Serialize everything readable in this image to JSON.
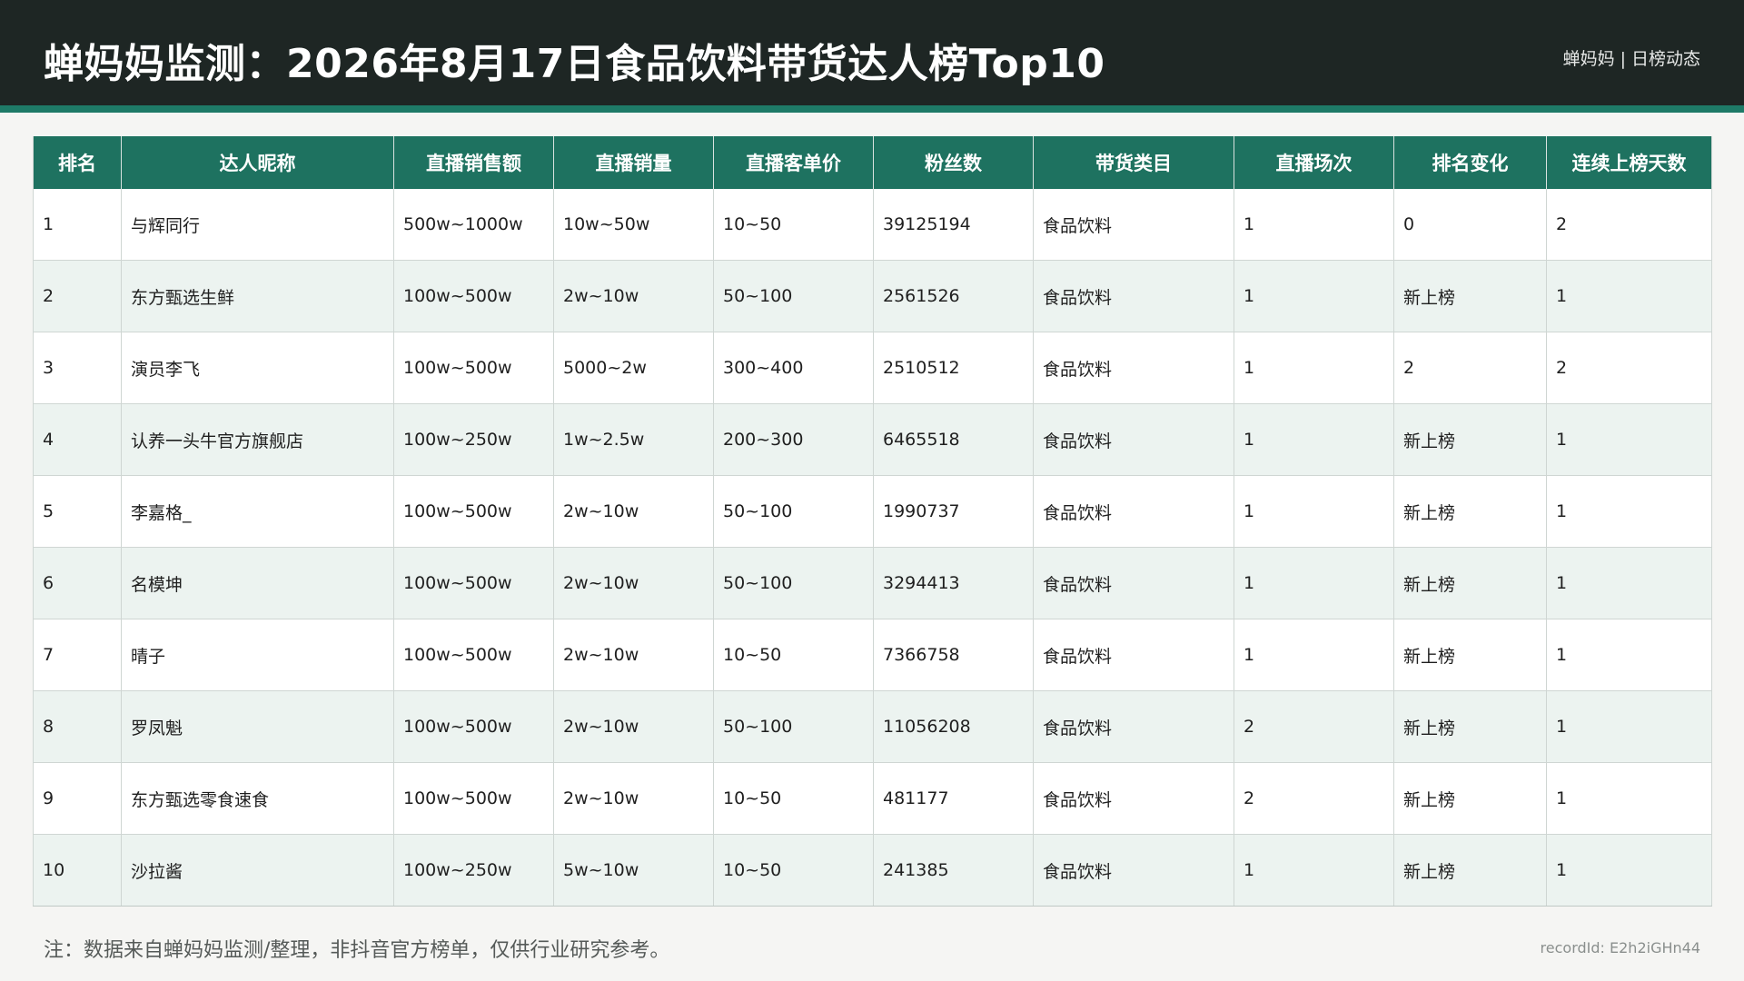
{
  "header": {
    "title": "蝉妈妈监测：2026年8月17日食品饮料带货达人榜Top10",
    "brand": "蝉妈妈",
    "brand_sep": "|",
    "brand_sub": "日榜动态"
  },
  "colors": {
    "header_bg": "#1e2624",
    "accent": "#1e7260",
    "row_alt": "#ecf3f0"
  },
  "table": {
    "columns": [
      "排名",
      "达人昵称",
      "直播销售额",
      "直播销量",
      "直播客单价",
      "粉丝数",
      "带货类目",
      "直播场次",
      "排名变化",
      "连续上榜天数"
    ],
    "rows": [
      [
        "1",
        "与辉同行",
        "500w~1000w",
        "10w~50w",
        "10~50",
        "39125194",
        "食品饮料",
        "1",
        "0",
        "2"
      ],
      [
        "2",
        "东方甄选生鲜",
        "100w~500w",
        "2w~10w",
        "50~100",
        "2561526",
        "食品饮料",
        "1",
        "新上榜",
        "1"
      ],
      [
        "3",
        "演员李飞",
        "100w~500w",
        "5000~2w",
        "300~400",
        "2510512",
        "食品饮料",
        "1",
        "2",
        "2"
      ],
      [
        "4",
        "认养一头牛官方旗舰店",
        "100w~250w",
        "1w~2.5w",
        "200~300",
        "6465518",
        "食品饮料",
        "1",
        "新上榜",
        "1"
      ],
      [
        "5",
        "李嘉格_",
        "100w~500w",
        "2w~10w",
        "50~100",
        "1990737",
        "食品饮料",
        "1",
        "新上榜",
        "1"
      ],
      [
        "6",
        "名模坤",
        "100w~500w",
        "2w~10w",
        "50~100",
        "3294413",
        "食品饮料",
        "1",
        "新上榜",
        "1"
      ],
      [
        "7",
        "晴子",
        "100w~500w",
        "2w~10w",
        "10~50",
        "7366758",
        "食品饮料",
        "1",
        "新上榜",
        "1"
      ],
      [
        "8",
        "罗凤魁",
        "100w~500w",
        "2w~10w",
        "50~100",
        "11056208",
        "食品饮料",
        "2",
        "新上榜",
        "1"
      ],
      [
        "9",
        "东方甄选零食速食",
        "100w~500w",
        "2w~10w",
        "10~50",
        "481177",
        "食品饮料",
        "2",
        "新上榜",
        "1"
      ],
      [
        "10",
        "沙拉酱",
        "100w~250w",
        "5w~10w",
        "10~50",
        "241385",
        "食品饮料",
        "1",
        "新上榜",
        "1"
      ]
    ]
  },
  "footer": {
    "note": "注：数据来自蝉妈妈监测/整理，非抖音官方榜单，仅供行业研究参考。",
    "record": "recordId: E2h2iGHn44"
  }
}
